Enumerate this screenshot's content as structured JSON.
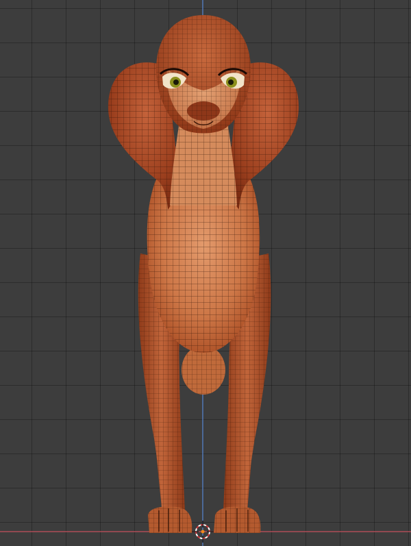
{
  "viewport": {
    "view": "front-orthographic",
    "grid": true,
    "colors": {
      "background": "#3d3d3d",
      "grid_line": "#303030",
      "z_axis": "#5b8bd9",
      "x_axis": "#c5515b",
      "mesh_dark": "#9a3c1c",
      "mesh_mid": "#b8592e",
      "mesh_light": "#d9895c",
      "wireframe": "#2e1206",
      "eye": "#8c8f1c"
    },
    "object": {
      "type": "mesh",
      "wireframe_overlay": true,
      "description_icon": "character-mesh-icon"
    },
    "cursor": {
      "icon": "3d-cursor-icon"
    }
  }
}
